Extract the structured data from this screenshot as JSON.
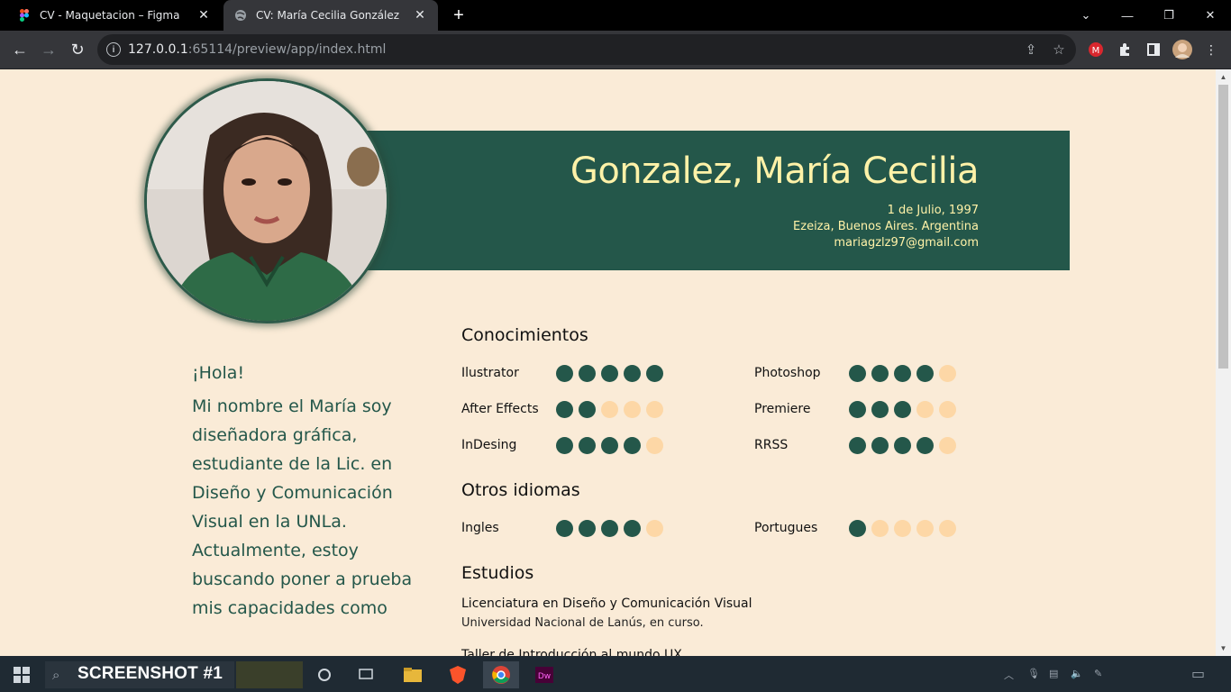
{
  "browser": {
    "tabs": [
      {
        "title": "CV - Maquetacion – Figma",
        "active": false,
        "icon": "figma-icon"
      },
      {
        "title": "CV: María Cecilia González",
        "active": true,
        "icon": "globe-icon"
      }
    ],
    "url_host": "127.0.0.1",
    "url_rest": ":65114/preview/app/index.html"
  },
  "cv": {
    "name": "Gonzalez, María Cecilia",
    "birthdate": "1 de Julio, 1997",
    "location": "Ezeiza, Buenos Aires. Argentina",
    "email": "mariagzlz97@gmail.com",
    "greeting": "¡Hola!",
    "bio": "Mi nombre el María soy diseñadora gráfica, estudiante de la Lic. en Diseño y Comunicación Visual en la UNLa. Actualmente, estoy buscando poner a prueba mis capacidades como",
    "sections": {
      "knowledge": "Conocimientos",
      "languages": "Otros idiomas",
      "studies": "Estudios"
    },
    "skills": [
      {
        "label": "Ilustrator",
        "level": 5
      },
      {
        "label": "Photoshop",
        "level": 4
      },
      {
        "label": "After Effects",
        "level": 2
      },
      {
        "label": "Premiere",
        "level": 3
      },
      {
        "label": "InDesing",
        "level": 4
      },
      {
        "label": "RRSS",
        "level": 4
      }
    ],
    "languages": [
      {
        "label": "Ingles",
        "level": 4
      },
      {
        "label": "Portugues",
        "level": 1
      }
    ],
    "level_max": 5,
    "studies": [
      {
        "title": "Licenciatura en Diseño y Comunicación Visual",
        "detail": "Universidad Nacional de Lanús, en curso."
      },
      {
        "title": "Taller de Introducción al mundo UX",
        "detail": ""
      }
    ],
    "colors": {
      "primary": "#24574a",
      "accent": "#fff2a8",
      "background": "#faebd7",
      "dot_off": "#fdd7a6"
    }
  },
  "taskbar": {
    "label": "SCREENSHOT #1"
  }
}
